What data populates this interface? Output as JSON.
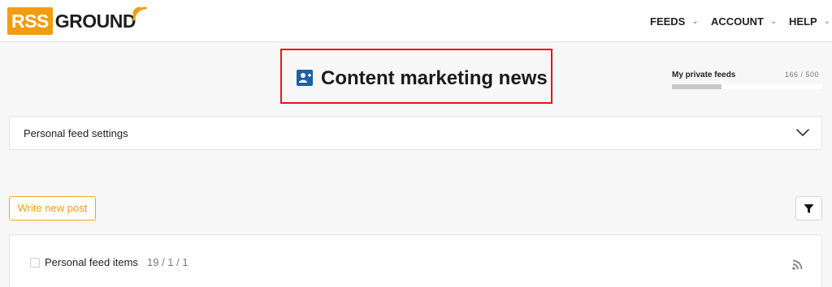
{
  "brand": {
    "logo_left": "RSS",
    "logo_right": "GROUND",
    "accent_color": "#f39c12"
  },
  "nav": {
    "feeds": "FEEDS",
    "account": "ACCOUNT",
    "help": "HELP",
    "chevron": "⌄"
  },
  "page": {
    "title": "Content marketing news",
    "icon": "add-user-icon",
    "highlight_color": "#e8141b"
  },
  "quota": {
    "label": "My private feeds",
    "count": "166 / 500",
    "used": 166,
    "total": 500
  },
  "settings": {
    "label": "Personal feed settings",
    "icon": "chevron-down-icon"
  },
  "toolbar": {
    "write_post": "Write new post",
    "filter_icon": "filter-icon"
  },
  "items": {
    "label": "Personal feed items",
    "counts": "19 / 1 / 1",
    "icon": "rss-icon"
  }
}
